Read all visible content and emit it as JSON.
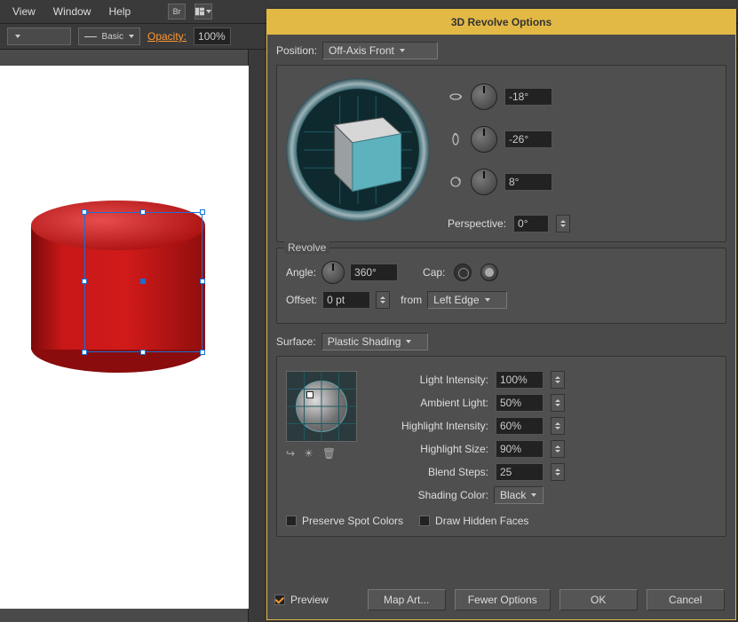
{
  "menu": {
    "items": [
      "View",
      "Window",
      "Help"
    ],
    "br_label": "Br"
  },
  "toolbar": {
    "stroke_style": "Basic",
    "opacity_label": "Opacity:",
    "opacity_value": "100%"
  },
  "dialog": {
    "title": "3D Revolve Options",
    "position_label": "Position:",
    "position_value": "Off-Axis Front",
    "axes": {
      "x": "-18°",
      "y": "-26°",
      "z": "8°"
    },
    "perspective_label": "Perspective:",
    "perspective_value": "0°",
    "revolve": {
      "legend": "Revolve",
      "angle_label": "Angle:",
      "angle_value": "360°",
      "cap_label": "Cap:",
      "offset_label": "Offset:",
      "offset_value": "0 pt",
      "from_label": "from",
      "from_value": "Left Edge"
    },
    "surface": {
      "label": "Surface:",
      "value": "Plastic Shading",
      "light_intensity_label": "Light Intensity:",
      "light_intensity": "100%",
      "ambient_label": "Ambient Light:",
      "ambient": "50%",
      "hi_intensity_label": "Highlight Intensity:",
      "hi_intensity": "60%",
      "hi_size_label": "Highlight Size:",
      "hi_size": "90%",
      "blend_label": "Blend Steps:",
      "blend": "25",
      "shading_color_label": "Shading Color:",
      "shading_color": "Black",
      "preserve_spot": "Preserve Spot Colors",
      "hidden_faces": "Draw Hidden Faces"
    },
    "footer": {
      "preview_label": "Preview",
      "preview_checked": true,
      "map_art": "Map Art...",
      "fewer": "Fewer Options",
      "ok": "OK",
      "cancel": "Cancel"
    }
  },
  "icons": {
    "rotate_x": "↻",
    "rotate_y": "↺",
    "rotate_z": "⟳",
    "move_back": "↪",
    "new_light": "☀",
    "trash": "🗑"
  }
}
